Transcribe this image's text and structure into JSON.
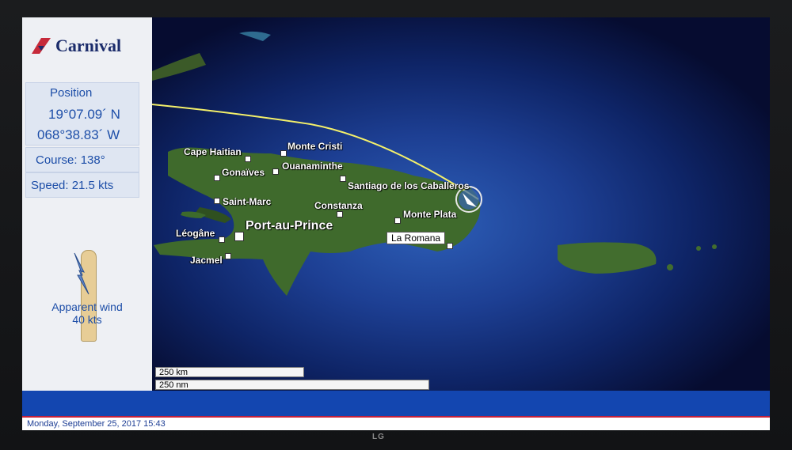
{
  "logo": {
    "text": "Carnival"
  },
  "position": {
    "title": "Position",
    "latitude": "19°07.09´ N",
    "longitude": "068°38.83´ W"
  },
  "course": "Course: 138°",
  "speed": "Speed: 21.5 kts",
  "wind": {
    "label_line1": "Apparent wind",
    "label_line2": "40 kts"
  },
  "map": {
    "cities": {
      "cape_haitian": "Cape Haitian",
      "monte_cristi": "Monte Cristi",
      "gonaives": "Gonaïves",
      "ouanaminthe": "Ouanaminthe",
      "santiago": "Santiago de los Caballeros",
      "saint_marc": "Saint-Marc",
      "constanza": "Constanza",
      "monte_plata": "Monte Plata",
      "leogane": "Léogâne",
      "port_au_prince": "Port-au-Prince",
      "la_romana": "La Romana",
      "jacmel": "Jacmel"
    },
    "scale_km": "250 km",
    "scale_nm": "250 nm"
  },
  "status": {
    "datetime": "Monday, September 25, 2017 15:43"
  },
  "device_brand": "LG",
  "colors": {
    "accent": "#1346b0",
    "route": "#f4f06a",
    "panel_text": "#1d4ea8"
  }
}
